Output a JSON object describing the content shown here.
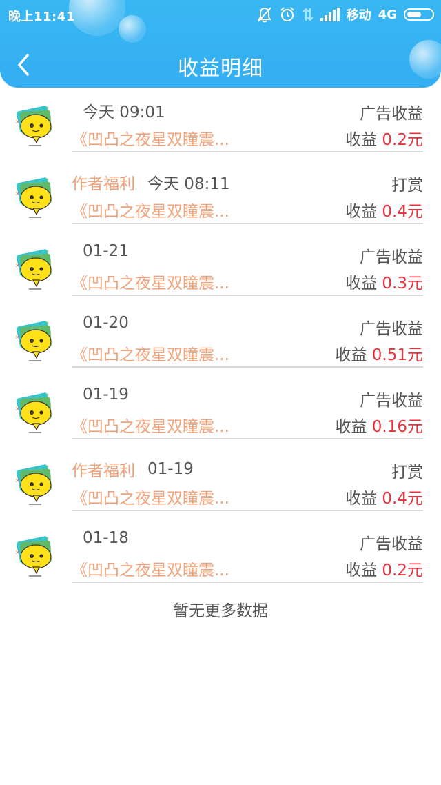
{
  "status_bar": {
    "time": "晚上11:41",
    "carrier": "移动",
    "network": "4G",
    "icons": [
      "bell-off-icon",
      "alarm-icon",
      "data-arrows-icon",
      "signal-icon",
      "battery-icon"
    ]
  },
  "nav": {
    "title": "收益明细",
    "back_icon": "chevron-left-icon"
  },
  "colors": {
    "header": "#36b2f2",
    "accent_orange": "#f0a27a",
    "amount_red": "#e8323c",
    "text_gray": "#555555"
  },
  "records": [
    {
      "tag": "",
      "time": "今天 09:01",
      "type": "广告收益",
      "book": "《凹凸之夜星双瞳震...",
      "earn_label": "收益",
      "amount": "0.2元"
    },
    {
      "tag": "作者福利",
      "time": "今天 08:11",
      "type": "打赏",
      "book": "《凹凸之夜星双瞳震...",
      "earn_label": "收益",
      "amount": "0.4元"
    },
    {
      "tag": "",
      "time": "01-21",
      "type": "广告收益",
      "book": "《凹凸之夜星双瞳震...",
      "earn_label": "收益",
      "amount": "0.3元"
    },
    {
      "tag": "",
      "time": "01-20",
      "type": "广告收益",
      "book": "《凹凸之夜星双瞳震...",
      "earn_label": "收益",
      "amount": "0.51元"
    },
    {
      "tag": "",
      "time": "01-19",
      "type": "广告收益",
      "book": "《凹凸之夜星双瞳震...",
      "earn_label": "收益",
      "amount": "0.16元"
    },
    {
      "tag": "作者福利",
      "time": "01-19",
      "type": "打赏",
      "book": "《凹凸之夜星双瞳震...",
      "earn_label": "收益",
      "amount": "0.4元"
    },
    {
      "tag": "",
      "time": "01-18",
      "type": "广告收益",
      "book": "《凹凸之夜星双瞳震...",
      "earn_label": "收益",
      "amount": "0.2元"
    }
  ],
  "footer_message": "暂无更多数据"
}
